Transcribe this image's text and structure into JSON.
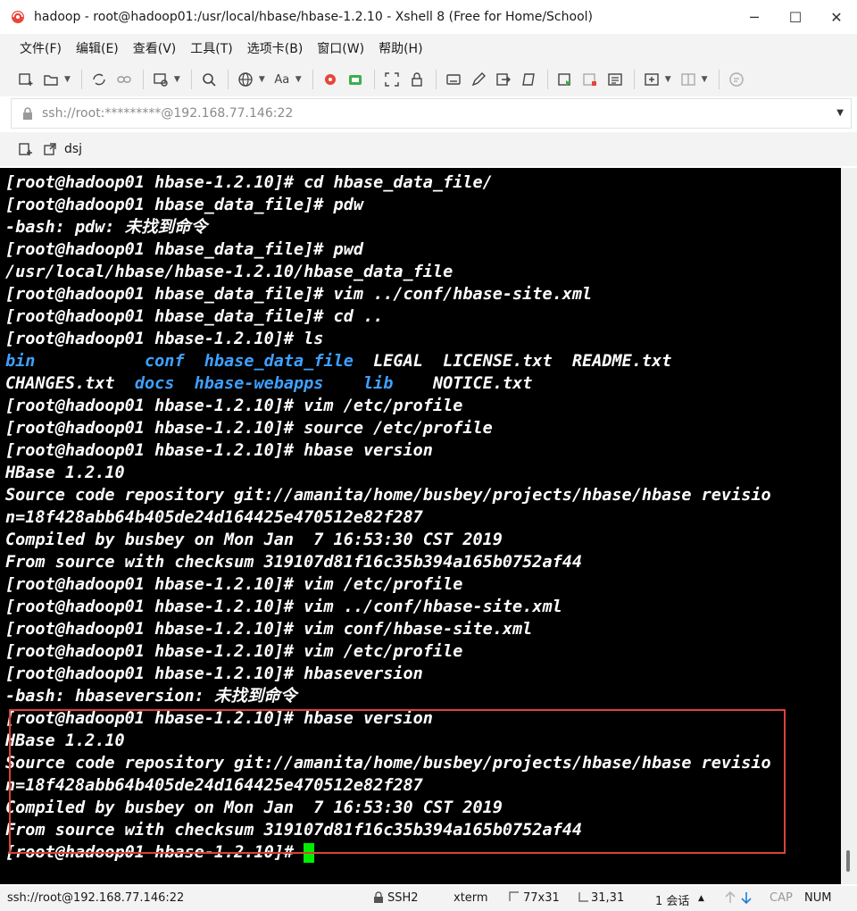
{
  "window": {
    "title": "hadoop - root@hadoop01:/usr/local/hbase/hbase-1.2.10 - Xshell 8 (Free for Home/School)",
    "controls": [
      "─",
      "☐",
      "✕"
    ]
  },
  "menu": [
    "文件(F)",
    "编辑(E)",
    "查看(V)",
    "工具(T)",
    "选项卡(B)",
    "窗口(W)",
    "帮助(H)"
  ],
  "address_bar": {
    "value": "ssh://root:*********@192.168.77.146:22"
  },
  "tab": {
    "label": "dsj"
  },
  "terminal": {
    "lines": [
      "[root@hadoop01 hbase-1.2.10]# cd hbase_data_file/",
      "[root@hadoop01 hbase_data_file]# pdw",
      "-bash: pdw: 未找到命令",
      "[root@hadoop01 hbase_data_file]# pwd",
      "/usr/local/hbase/hbase-1.2.10/hbase_data_file",
      "[root@hadoop01 hbase_data_file]# vim ../conf/hbase-site.xml",
      "[root@hadoop01 hbase_data_file]# cd ..",
      "[root@hadoop01 hbase-1.2.10]# ls",
      "[root@hadoop01 hbase-1.2.10]# vim /etc/profile",
      "[root@hadoop01 hbase-1.2.10]# source /etc/profile",
      "[root@hadoop01 hbase-1.2.10]# hbase version",
      "HBase 1.2.10",
      "Source code repository git://amanita/home/busbey/projects/hbase/hbase revisio",
      "n=18f428abb64b405de24d164425e470512e82f287",
      "Compiled by busbey on Mon Jan  7 16:53:30 CST 2019",
      "From source with checksum 319107d81f16c35b394a165b0752af44",
      "[root@hadoop01 hbase-1.2.10]# vim /etc/profile",
      "[root@hadoop01 hbase-1.2.10]# vim ../conf/hbase-site.xml",
      "[root@hadoop01 hbase-1.2.10]# vim conf/hbase-site.xml",
      "[root@hadoop01 hbase-1.2.10]# vim /etc/profile",
      "[root@hadoop01 hbase-1.2.10]# hbaseversion",
      "-bash: hbaseversion: 未找到命令",
      "[root@hadoop01 hbase-1.2.10]# hbase version",
      "HBase 1.2.10",
      "Source code repository git://amanita/home/busbey/projects/hbase/hbase revisio",
      "n=18f428abb64b405de24d164425e470512e82f287",
      "Compiled by busbey on Mon Jan  7 16:53:30 CST 2019",
      "From source with checksum 319107d81f16c35b394a165b0752af44"
    ],
    "ls_row1": [
      "bin",
      "conf",
      "hbase_data_file",
      "LEGAL",
      "LICENSE.txt",
      "README.txt"
    ],
    "ls_row2": [
      "CHANGES.txt",
      "docs",
      "hbase-webapps",
      "lib",
      "NOTICE.txt"
    ],
    "prompt": "[root@hadoop01 hbase-1.2.10]# ",
    "colors": {
      "background": "#000000",
      "text": "#ffffff",
      "directory": "#3fa0ff",
      "cursor": "#00ee00",
      "highlight_box": "#d9433a"
    }
  },
  "status": {
    "connection": "ssh://root@192.168.77.146:22",
    "protocol": "SSH2",
    "terminal_type": "xterm",
    "size": "77x31",
    "position": "31,31",
    "sessions": "1 会话",
    "caps": "CAP",
    "num": "NUM"
  }
}
